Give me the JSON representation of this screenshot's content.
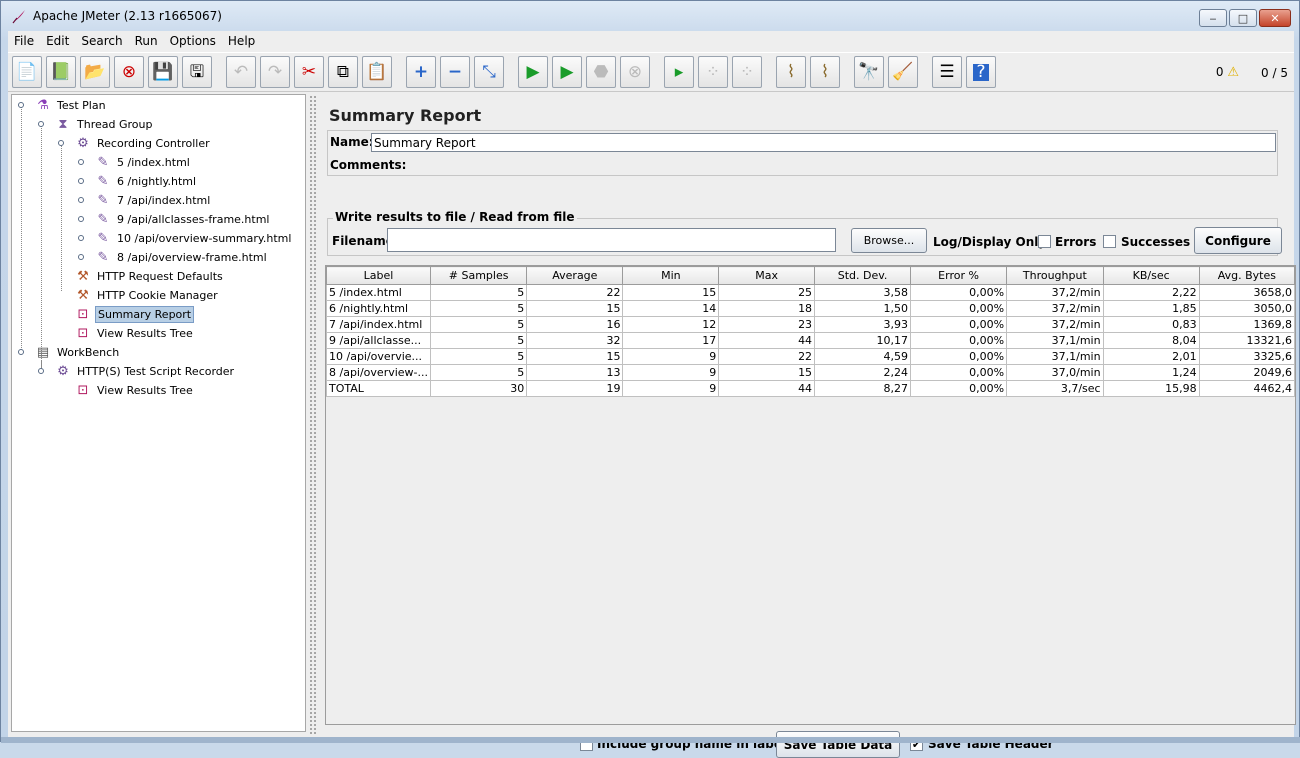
{
  "window": {
    "title": "Apache JMeter (2.13 r1665067)",
    "minimize_label": "‒",
    "maximize_label": "□",
    "close_label": "✕"
  },
  "menu": {
    "file": "File",
    "edit": "Edit",
    "search": "Search",
    "run": "Run",
    "options": "Options",
    "help": "Help"
  },
  "toolbar_icons": [
    "new-icon",
    "templates-icon",
    "open-icon",
    "close-icon",
    "save-icon",
    "save-as-icon",
    "undo-icon",
    "redo-icon",
    "cut-icon",
    "copy-icon",
    "paste-icon",
    "expand-icon",
    "collapse-icon",
    "toggle-icon",
    "start-icon",
    "start-no-pause-icon",
    "stop-icon",
    "shutdown-icon",
    "remote-start-icon",
    "remote-stop-icon",
    "remote-exit-icon",
    "clear-icon",
    "clear-all-icon",
    "search-icon",
    "reset-search-icon",
    "function-helper-icon",
    "help-icon"
  ],
  "status": {
    "warnings": "0",
    "threads": "0 / 5"
  },
  "tree": {
    "nodes": [
      {
        "label": "Test Plan"
      },
      {
        "label": "Thread Group"
      },
      {
        "label": "Recording Controller"
      },
      {
        "label": "5 /index.html"
      },
      {
        "label": "6 /nightly.html"
      },
      {
        "label": "7 /api/index.html"
      },
      {
        "label": "9 /api/allclasses-frame.html"
      },
      {
        "label": "10 /api/overview-summary.html"
      },
      {
        "label": "8 /api/overview-frame.html"
      },
      {
        "label": "HTTP Request Defaults"
      },
      {
        "label": "HTTP Cookie Manager"
      },
      {
        "label": "Summary Report"
      },
      {
        "label": "View Results Tree"
      },
      {
        "label": "WorkBench"
      },
      {
        "label": "HTTP(S) Test Script Recorder"
      },
      {
        "label": "View Results Tree"
      }
    ],
    "selected": "Summary Report"
  },
  "panel": {
    "title": "Summary Report",
    "name_label": "Name:",
    "name_value": "Summary Report",
    "comments_label": "Comments:",
    "file_group_title": "Write results to file / Read from file",
    "filename_label": "Filename",
    "filename_value": "",
    "browse_label": "Browse...",
    "log_display_label": "Log/Display Only:",
    "errors_label": "Errors",
    "successes_label": "Successes",
    "configure_label": "Configure"
  },
  "table": {
    "headers": [
      "Label",
      "# Samples",
      "Average",
      "Min",
      "Max",
      "Std. Dev.",
      "Error %",
      "Throughput",
      "KB/sec",
      "Avg. Bytes"
    ],
    "rows": [
      [
        "5 /index.html",
        "5",
        "22",
        "15",
        "25",
        "3,58",
        "0,00%",
        "37,2/min",
        "2,22",
        "3658,0"
      ],
      [
        "6 /nightly.html",
        "5",
        "15",
        "14",
        "18",
        "1,50",
        "0,00%",
        "37,2/min",
        "1,85",
        "3050,0"
      ],
      [
        "7 /api/index.html",
        "5",
        "16",
        "12",
        "23",
        "3,93",
        "0,00%",
        "37,2/min",
        "0,83",
        "1369,8"
      ],
      [
        "9 /api/allclasse...",
        "5",
        "32",
        "17",
        "44",
        "10,17",
        "0,00%",
        "37,1/min",
        "8,04",
        "13321,6"
      ],
      [
        "10 /api/overvie...",
        "5",
        "15",
        "9",
        "22",
        "4,59",
        "0,00%",
        "37,1/min",
        "2,01",
        "3325,6"
      ],
      [
        "8 /api/overview-...",
        "5",
        "13",
        "9",
        "15",
        "2,24",
        "0,00%",
        "37,0/min",
        "1,24",
        "2049,6"
      ],
      [
        "TOTAL",
        "30",
        "19",
        "9",
        "44",
        "8,27",
        "0,00%",
        "3,7/sec",
        "15,98",
        "4462,4"
      ]
    ]
  },
  "bottom": {
    "include_group_label": "Include group name in label?",
    "include_group_checked": false,
    "save_table_data_label": "Save Table Data",
    "save_table_header_label": "Save Table Header",
    "save_table_header_checked": true,
    "check_mark": "✔"
  }
}
